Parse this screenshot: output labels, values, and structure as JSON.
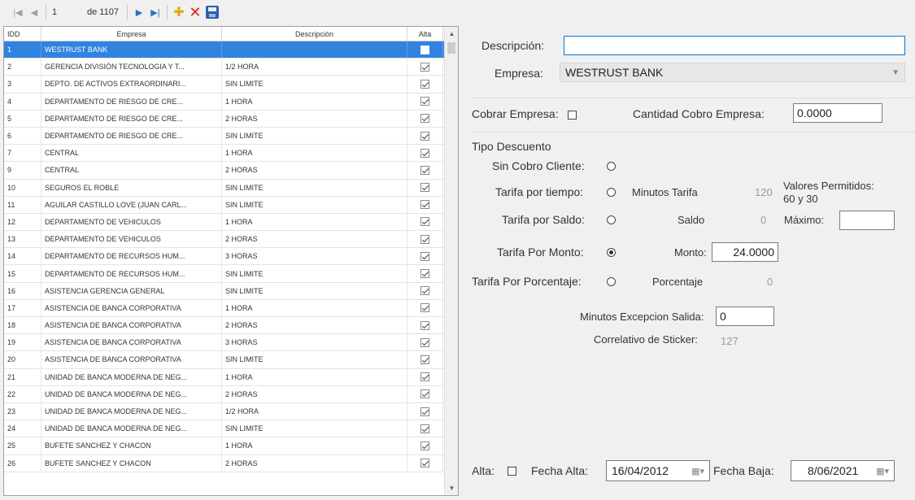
{
  "toolbar": {
    "position": "1",
    "of_label": "de 1107",
    "first_glyph": "|◀",
    "prev_glyph": "◀",
    "next_glyph": "▶",
    "last_glyph": "▶|",
    "add_glyph": "✚",
    "delete_glyph": "✕"
  },
  "grid": {
    "columns": [
      "IDD",
      "Empresa",
      "Descripción",
      "Alta"
    ],
    "rows": [
      {
        "id": "1",
        "empresa": "WESTRUST BANK",
        "descripcion": "",
        "alta": false,
        "selected": true
      },
      {
        "id": "2",
        "empresa": "GERENCIA DIVISIÓN TECNOLOGIA Y T...",
        "descripcion": "1/2 HORA",
        "alta": true
      },
      {
        "id": "3",
        "empresa": "DEPTO. DE ACTIVOS EXTRAORDINARI...",
        "descripcion": "SIN LIMITE",
        "alta": true
      },
      {
        "id": "4",
        "empresa": "DEPARTAMENTO DE RIESGO DE CRE...",
        "descripcion": "1 HORA",
        "alta": true
      },
      {
        "id": "5",
        "empresa": "DEPARTAMENTO DE RIESGO DE CRE...",
        "descripcion": "2 HORAS",
        "alta": true
      },
      {
        "id": "6",
        "empresa": "DEPARTAMENTO DE RIESGO DE CRE...",
        "descripcion": "SIN LIMITE",
        "alta": true
      },
      {
        "id": "7",
        "empresa": "CENTRAL",
        "descripcion": "1 HORA",
        "alta": true
      },
      {
        "id": "9",
        "empresa": "CENTRAL",
        "descripcion": "2 HORAS",
        "alta": true
      },
      {
        "id": "10",
        "empresa": "SEGUROS EL ROBLE",
        "descripcion": "SIN LIMITE",
        "alta": true
      },
      {
        "id": "11",
        "empresa": "AGUILAR CASTILLO LOVE (JUAN CARL...",
        "descripcion": "SIN LIMITE",
        "alta": true
      },
      {
        "id": "12",
        "empresa": "DEPARTAMENTO DE VEHICULOS",
        "descripcion": "1 HORA",
        "alta": true
      },
      {
        "id": "13",
        "empresa": "DEPARTAMENTO DE VEHICULOS",
        "descripcion": "2 HORAS",
        "alta": true
      },
      {
        "id": "14",
        "empresa": "DEPARTAMENTO DE RECURSOS HUM...",
        "descripcion": "3 HORAS",
        "alta": true
      },
      {
        "id": "15",
        "empresa": "DEPARTAMENTO DE RECURSOS HUM...",
        "descripcion": "SIN LIMITE",
        "alta": true
      },
      {
        "id": "16",
        "empresa": "ASISTENCIA GERENCIA GENERAL",
        "descripcion": "SIN LIMITE",
        "alta": true
      },
      {
        "id": "17",
        "empresa": "ASISTENCIA DE BANCA CORPORATIVA",
        "descripcion": "1 HORA",
        "alta": true
      },
      {
        "id": "18",
        "empresa": "ASISTENCIA DE BANCA CORPORATIVA",
        "descripcion": "2 HORAS",
        "alta": true
      },
      {
        "id": "19",
        "empresa": "ASISTENCIA DE BANCA CORPORATIVA",
        "descripcion": "3 HORAS",
        "alta": true
      },
      {
        "id": "20",
        "empresa": "ASISTENCIA DE BANCA CORPORATIVA",
        "descripcion": "SIN LIMITE",
        "alta": true
      },
      {
        "id": "21",
        "empresa": "UNIDAD DE BANCA MODERNA DE NEG...",
        "descripcion": "1 HORA",
        "alta": true
      },
      {
        "id": "22",
        "empresa": "UNIDAD DE BANCA MODERNA DE NEG...",
        "descripcion": "2 HORAS",
        "alta": true
      },
      {
        "id": "23",
        "empresa": "UNIDAD DE BANCA MODERNA DE NEG...",
        "descripcion": "1/2 HORA",
        "alta": true
      },
      {
        "id": "24",
        "empresa": "UNIDAD DE BANCA MODERNA DE NEG...",
        "descripcion": "SIN LIMITE",
        "alta": true
      },
      {
        "id": "25",
        "empresa": "BUFETE SANCHEZ Y CHACON",
        "descripcion": "1 HORA",
        "alta": true
      },
      {
        "id": "26",
        "empresa": "BUFETE SANCHEZ Y CHACON",
        "descripcion": "2 HORAS",
        "alta": true
      }
    ]
  },
  "form": {
    "descripcion_label": "Descripción:",
    "descripcion_value": "",
    "empresa_label": "Empresa:",
    "empresa_value": "WESTRUST BANK",
    "cobrar_label": "Cobrar Empresa:",
    "cantidad_label": "Cantidad Cobro Empresa:",
    "cantidad_value": "0.0000",
    "tipo_label": "Tipo Descuento",
    "sin_cobro_label": "Sin Cobro Cliente:",
    "tarifa_tiempo_label": "Tarifa por tiempo:",
    "minutos_tarifa_label": "Minutos Tarifa",
    "minutos_tarifa_value": "120",
    "valores_label_1": "Valores Permitidos:",
    "valores_label_2": "60 y 30",
    "tarifa_saldo_label": "Tarifa por Saldo:",
    "saldo_label": "Saldo",
    "saldo_value": "0",
    "maximo_label": "Máximo:",
    "maximo_value": "",
    "tarifa_monto_label": "Tarifa Por Monto:",
    "monto_label": "Monto:",
    "monto_value": "24.0000",
    "tarifa_porcentaje_label": "Tarifa Por Porcentaje:",
    "porcentaje_label": "Porcentaje",
    "porcentaje_value": "0",
    "minutos_excepcion_label": "Minutos Excepcion Salida:",
    "minutos_excepcion_value": "0",
    "correlativo_label": "Correlativo de Sticker:",
    "correlativo_value": "127",
    "alta_label": "Alta:",
    "fecha_alta_label": "Fecha Alta:",
    "fecha_alta_value": "16/04/2012",
    "fecha_baja_label": "Fecha Baja:",
    "fecha_baja_value": "8/06/2021"
  }
}
